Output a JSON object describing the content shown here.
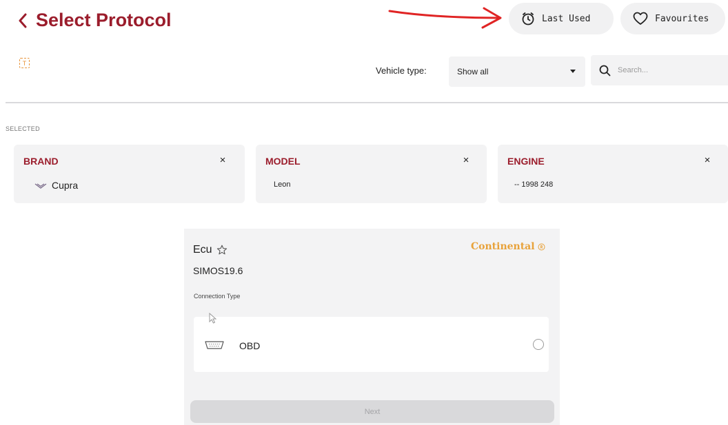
{
  "header": {
    "title": "Select Protocol",
    "last_used_label": "Last Used",
    "favourites_label": "Favourites"
  },
  "toolbar": {
    "t_badge": "T",
    "vehicle_type_label": "Vehicle type:",
    "vehicle_type_value": "Show all",
    "search_placeholder": "Search..."
  },
  "selected": {
    "label": "SELECTED",
    "cards": [
      {
        "title": "BRAND",
        "value": "Cupra"
      },
      {
        "title": "MODEL",
        "value": "Leon"
      },
      {
        "title": "ENGINE",
        "value": "-- 1998 248"
      }
    ],
    "close_glyph": "×"
  },
  "ecu": {
    "title": "Ecu",
    "subtitle": "SIMOS19.6",
    "manufacturer_logo": "Continental",
    "connection_type_label": "Connection Type",
    "connection_option": "OBD"
  },
  "footer": {
    "next_label": "Next"
  },
  "colors": {
    "accent": "#9b1d2c",
    "panel_bg": "#f3f3f4",
    "logo": "#e8a23a",
    "annotation_arrow": "#e02424"
  },
  "icons": {
    "back": "chevron-left-icon",
    "last_used": "clock-icon",
    "favourites": "heart-icon",
    "dropdown": "caret-down-icon",
    "search": "search-icon",
    "close": "close-icon",
    "brand_logo": "cupra-logo-icon",
    "favourite_star": "star-outline-icon",
    "obd": "obd-connector-icon"
  }
}
